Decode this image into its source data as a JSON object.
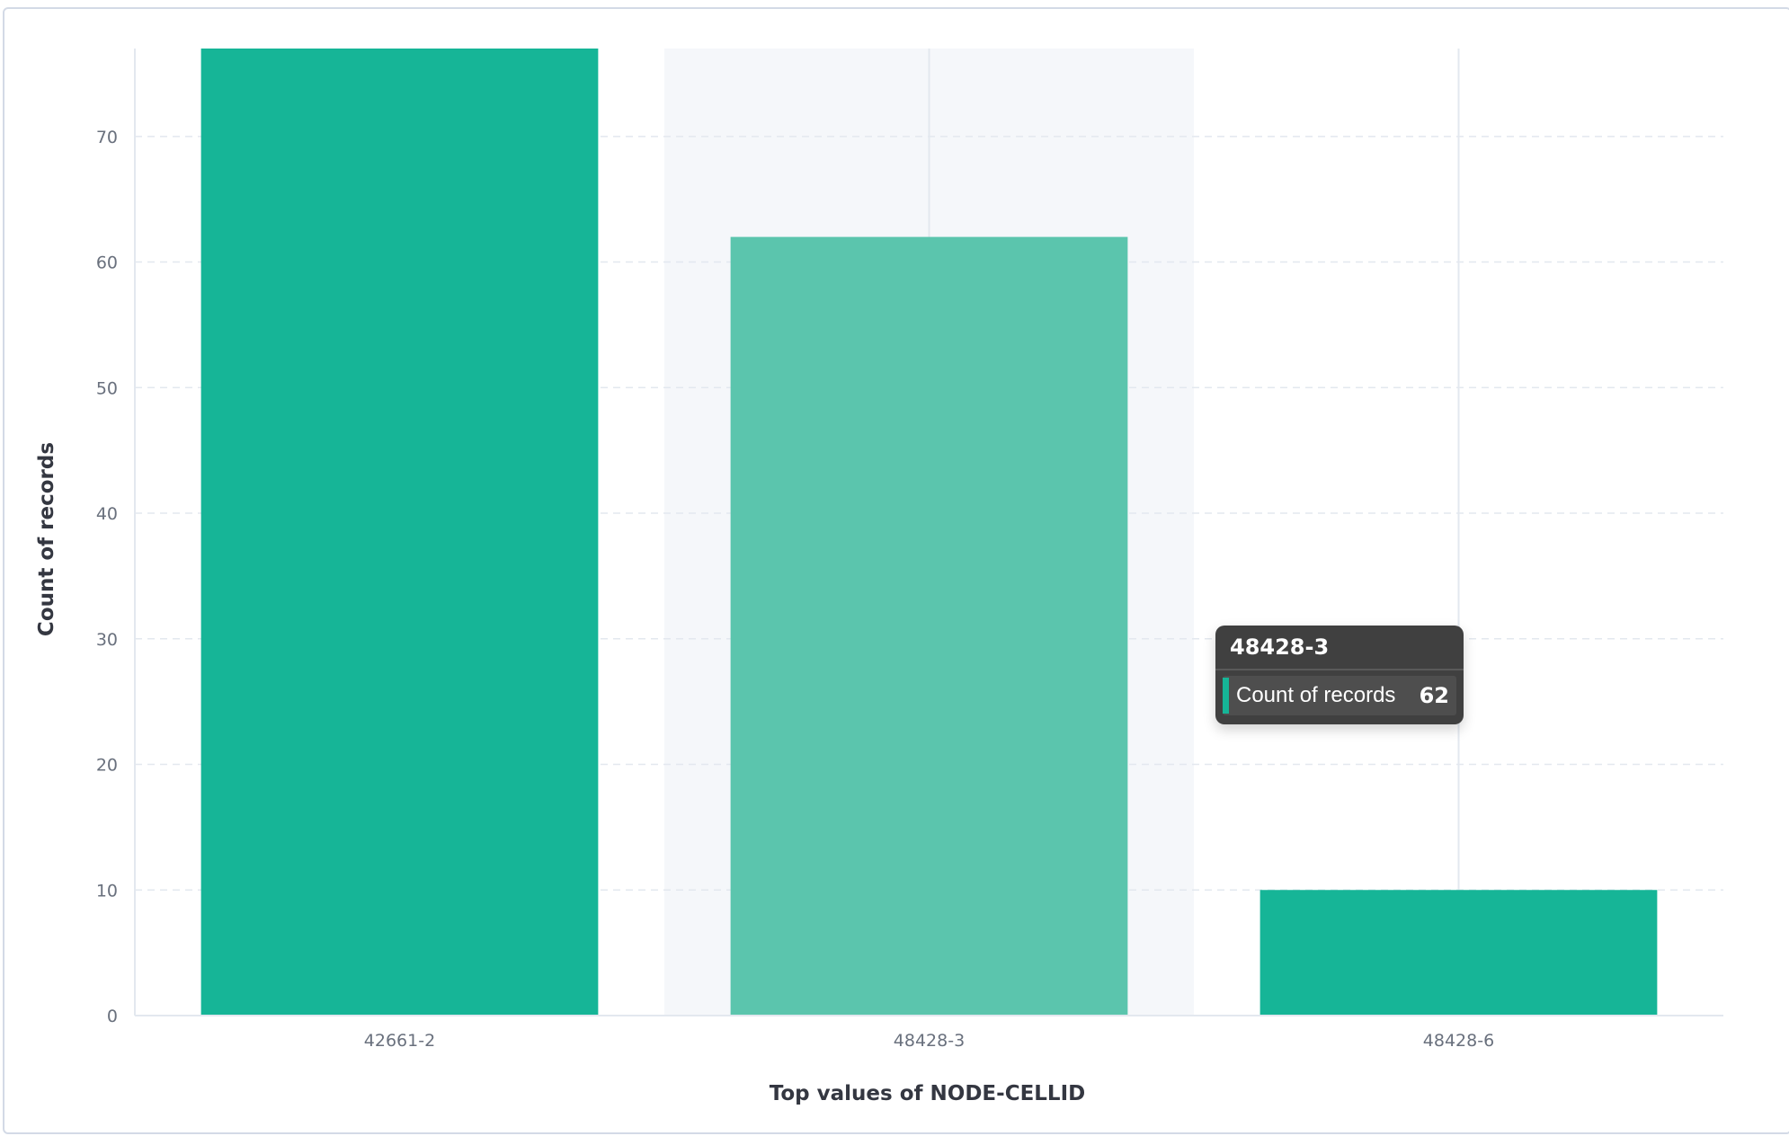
{
  "chart_data": {
    "type": "bar",
    "title": "",
    "xlabel": "Top values of NODE-CELLID",
    "ylabel": "Count of records",
    "categories": [
      "42661-2",
      "48428-3",
      "48428-6"
    ],
    "series": [
      {
        "name": "Count of records",
        "values": [
          77,
          62,
          10
        ]
      }
    ],
    "ylim": [
      0,
      77
    ],
    "yticks": [
      0,
      10,
      20,
      30,
      40,
      50,
      60,
      70
    ],
    "grid": true,
    "highlighted_category": "48428-3",
    "colors": {
      "bar": "#16b597",
      "bar_highlight": "#5bc5ad",
      "hover_band": "#f5f7fa",
      "grid": "#e3e8ef",
      "tick_text": "#69707d",
      "axis_title": "#343741"
    }
  },
  "tooltip": {
    "title": "48428-3",
    "series_label": "Count of records",
    "value": "62"
  }
}
